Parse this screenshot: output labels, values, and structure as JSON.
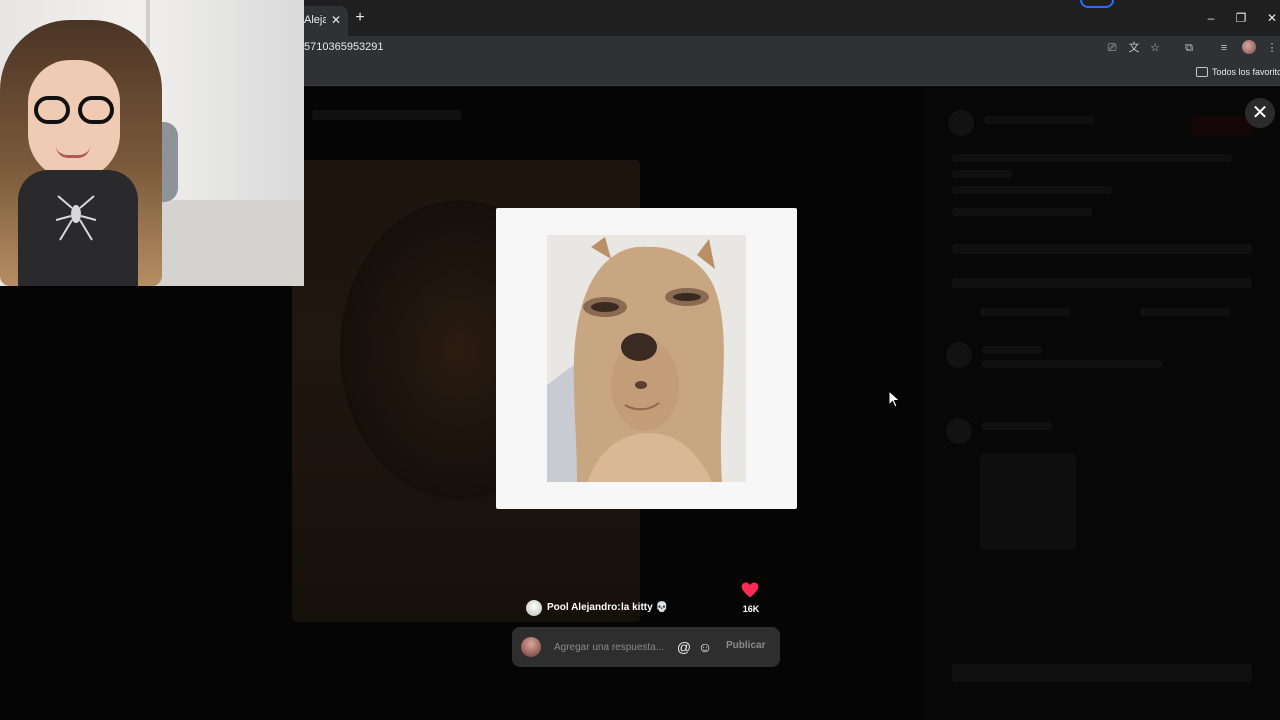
{
  "browser": {
    "tab_title": "Alejandro",
    "tab_close": "✕",
    "new_tab": "+",
    "url": "5710365953291",
    "window_minimize": "–",
    "window_restore": "❐",
    "window_close": "✕",
    "bookmarks_label": "Todos los favoritos"
  },
  "overlay": {
    "close_glyph": "✕"
  },
  "comment": {
    "author": "Pool Alejandro:",
    "text": "la kitty 💀",
    "likes": "16K"
  },
  "reply": {
    "placeholder": "Agregar una respuesta...",
    "mention_glyph": "@",
    "emoji_glyph": "☺",
    "publish_label": "Publicar"
  },
  "colors": {
    "heart": "#fe2c55",
    "modal_bg": "#f7f7f7",
    "reply_bar": "#2e2e2e"
  },
  "icons": [
    "cast-icon",
    "translate-icon",
    "bookmark-star-icon",
    "extensions-icon",
    "media-controls-icon",
    "profile-avatar-icon",
    "more-menu-icon",
    "folder-icon",
    "heart-icon",
    "at-icon",
    "emoji-icon",
    "close-icon"
  ]
}
